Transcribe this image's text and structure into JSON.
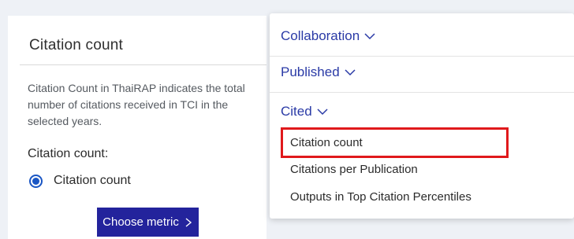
{
  "left_panel": {
    "title": "Citation count",
    "description": "Citation Count in ThaiRAP indicates the total number of citations received in TCI in the selected years.",
    "metric_label": "Citation count:",
    "radio_option": "Citation count",
    "choose_button": "Choose metric"
  },
  "dropdown": {
    "sections": {
      "collaboration": "Collaboration",
      "published": "Published",
      "cited": "Cited"
    },
    "cited_items": [
      "Citation count",
      "Citations per Publication",
      "Outputs in Top Citation Percentiles"
    ]
  },
  "colors": {
    "accent_blue": "#2a3aa6",
    "button_bg": "#23239c",
    "radio_blue": "#1a56c4",
    "highlight_red": "#e0191c"
  },
  "icons": [
    "chevron-down-icon",
    "chevron-right-icon",
    "radio-selected-icon"
  ]
}
